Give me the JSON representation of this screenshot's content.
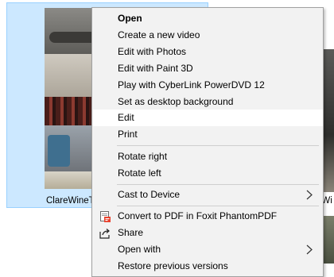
{
  "file": {
    "name": "ClareWineT",
    "next_name": "eWi"
  },
  "menu": {
    "items": [
      {
        "label": "Open",
        "bold": true
      },
      {
        "label": "Create a new video"
      },
      {
        "label": "Edit with Photos"
      },
      {
        "label": "Edit with Paint 3D"
      },
      {
        "label": "Play with CyberLink PowerDVD 12"
      },
      {
        "label": "Set as desktop background"
      },
      {
        "label": "Edit",
        "highlighted": true
      },
      {
        "label": "Print"
      },
      {
        "label": "Rotate right"
      },
      {
        "label": "Rotate left"
      },
      {
        "label": "Cast to Device",
        "submenu": true
      },
      {
        "label": "Convert to PDF in Foxit PhantomPDF",
        "icon": "foxit-pdf-icon"
      },
      {
        "label": "Share",
        "icon": "share-icon"
      },
      {
        "label": "Open with",
        "submenu": true
      },
      {
        "label": "Restore previous versions"
      }
    ]
  },
  "colors": {
    "selection_bg": "#cce8ff",
    "selection_border": "#99d1ff",
    "menu_bg": "#f2f2f2",
    "menu_hover": "#ffffff"
  }
}
